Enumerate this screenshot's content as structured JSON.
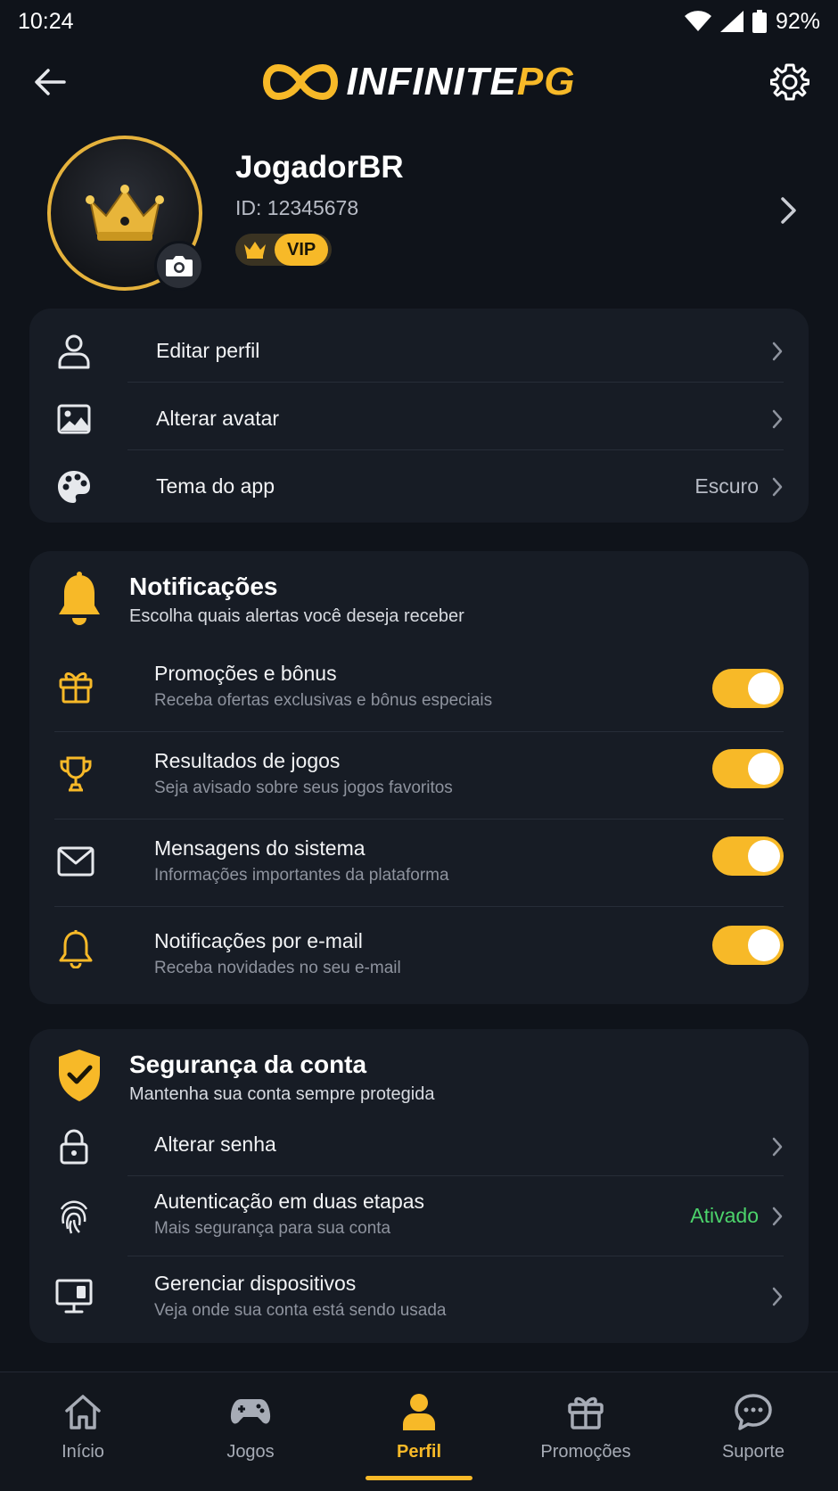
{
  "status_bar": {
    "time": "10:24",
    "battery": "92%"
  },
  "header": {
    "logo_main": "INFINITE",
    "logo_accent": "PG",
    "back_icon": "arrow-left-icon",
    "settings_icon": "gear-icon"
  },
  "profile": {
    "name": "JogadorBR",
    "id_text": "ID: 12345678",
    "badge": "VIP"
  },
  "account_menu": [
    {
      "label": "Editar perfil",
      "value": "",
      "icon": "user-icon"
    },
    {
      "label": "Alterar avatar",
      "value": "",
      "icon": "image-icon"
    },
    {
      "label": "Tema do app",
      "value": "Escuro",
      "icon": "palette-icon"
    }
  ],
  "notifications": {
    "title": "Notificações",
    "subtitle": "Escolha quais alertas você deseja receber",
    "items": [
      {
        "title": "Promoções e bônus",
        "subtitle": "Receba ofertas exclusivas e bônus especiais",
        "enabled": true,
        "icon": "gift-icon"
      },
      {
        "title": "Resultados de jogos",
        "subtitle": "Seja avisado sobre seus jogos favoritos",
        "enabled": true,
        "icon": "trophy-icon"
      },
      {
        "title": "Mensagens do sistema",
        "subtitle": "Informações importantes da plataforma",
        "enabled": true,
        "icon": "mail-icon"
      },
      {
        "title": "Notificações por e-mail",
        "subtitle": "Receba novidades no seu e-mail",
        "enabled": true,
        "icon": "bell-icon"
      }
    ]
  },
  "security": {
    "title": "Segurança da conta",
    "subtitle": "Mantenha sua conta sempre protegida",
    "items": [
      {
        "title": "Alterar senha",
        "subtitle": "",
        "value": "",
        "icon": "lock-icon"
      },
      {
        "title": "Autenticação em duas etapas",
        "subtitle": "Mais segurança para sua conta",
        "value": "Ativado",
        "icon": "fingerprint-icon"
      },
      {
        "title": "Gerenciar dispositivos",
        "subtitle": "Veja onde sua conta está sendo usada",
        "value": "",
        "icon": "monitor-icon"
      }
    ]
  },
  "bottom_nav": [
    {
      "label": "Início",
      "icon": "home-icon",
      "active": false
    },
    {
      "label": "Jogos",
      "icon": "gamepad-icon",
      "active": false
    },
    {
      "label": "Perfil",
      "icon": "person-icon",
      "active": true
    },
    {
      "label": "Promoções",
      "icon": "gift-icon",
      "active": false
    },
    {
      "label": "Suporte",
      "icon": "chat-icon",
      "active": false
    }
  ],
  "colors": {
    "accent": "#f7b928",
    "background": "#0f131a",
    "card": "#171c25",
    "success": "#4cd36b"
  }
}
